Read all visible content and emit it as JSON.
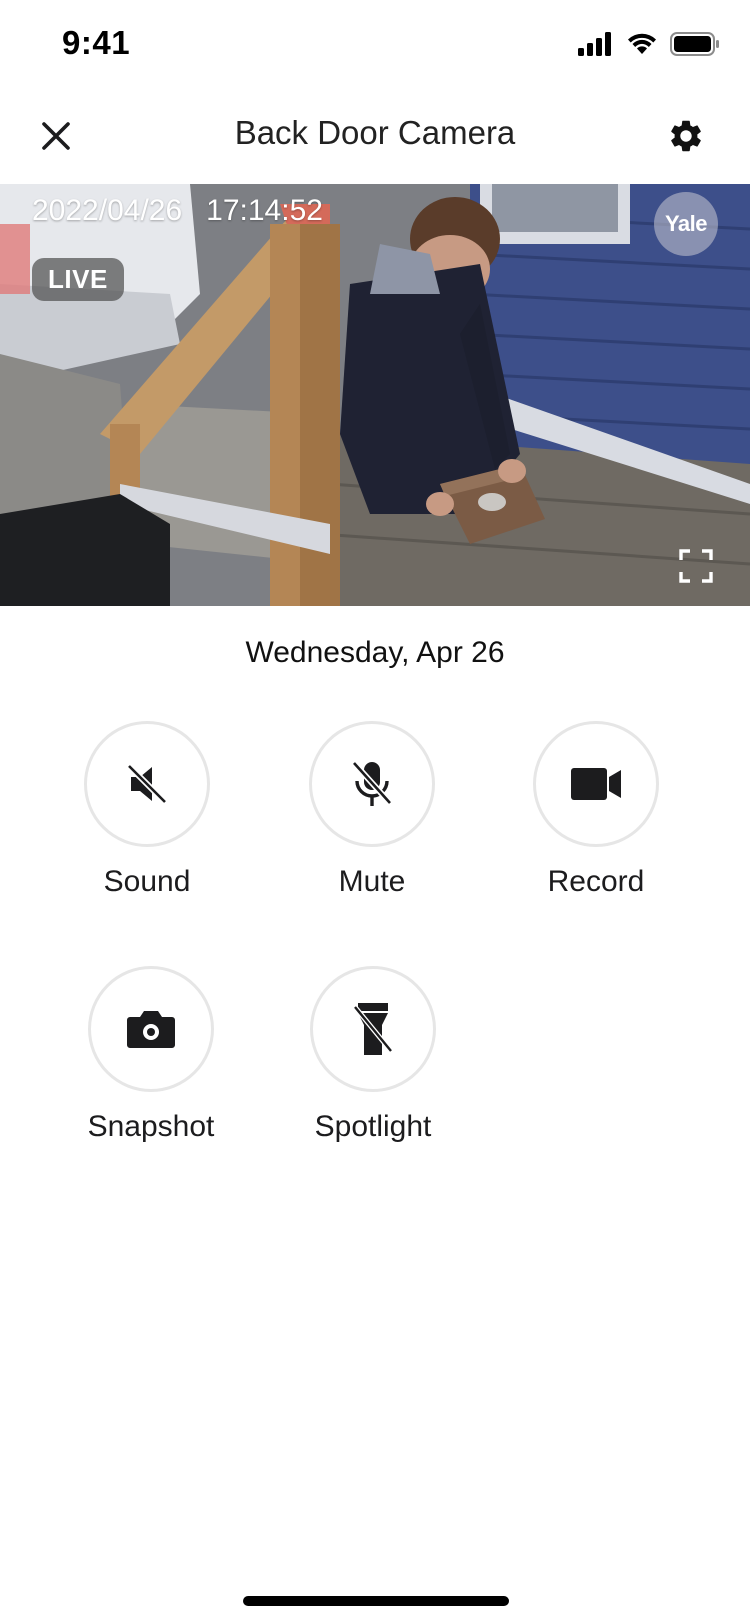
{
  "status_bar": {
    "time": "9:41",
    "icons": [
      "signal-icon",
      "wifi-icon",
      "battery-icon"
    ]
  },
  "header": {
    "title": "Back Door Camera",
    "close_icon": "close-icon",
    "settings_icon": "gear-icon"
  },
  "video": {
    "date_stamp": "2022/04/26",
    "time_stamp": "17:14:52",
    "live_label": "LIVE",
    "logo_text": "Yale",
    "fullscreen_icon": "fullscreen-icon"
  },
  "date_label": "Wednesday, Apr 26",
  "controls": [
    {
      "label": "Sound",
      "icon": "speaker-muted-icon"
    },
    {
      "label": "Mute",
      "icon": "microphone-off-icon"
    },
    {
      "label": "Record",
      "icon": "video-camera-icon"
    },
    {
      "label": "Snapshot",
      "icon": "camera-icon"
    },
    {
      "label": "Spotlight",
      "icon": "flashlight-off-icon"
    }
  ],
  "colors": {
    "icon": "#1c1c1e",
    "circle_border": "#e6e6e6",
    "live_badge_bg": "#505050"
  }
}
